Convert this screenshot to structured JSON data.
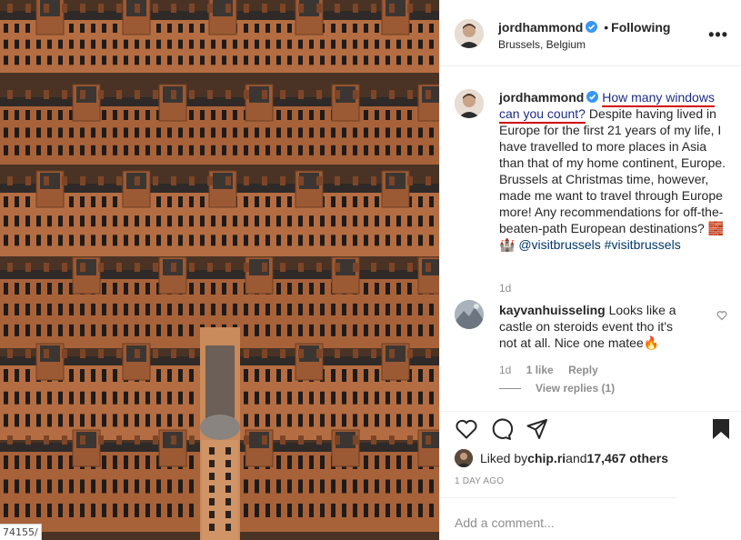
{
  "post": {
    "image_alt": "Aerial view of brick apartment blocks"
  },
  "url_stub": "74155/",
  "author": {
    "username": "jordhammond",
    "follow_status": "Following",
    "separator": "•",
    "location": "Brussels, Belgium"
  },
  "more_label": "•••",
  "caption": {
    "username": "jordhammond",
    "highlight": "How many windows can you count?",
    "body": " Despite having lived in Europe for the first 21 years of my life, I have travelled to more places in Asia than that of my home continent, Europe. Brussels at Christmas time, however, made me want to travel through Europe more! Any recommendations for off-the-beaten-path European destinations? 🧱🏰 ",
    "tag1": "@visitbrussels",
    "tag2": "#visitbrussels",
    "timestamp": "1d"
  },
  "comment": {
    "username": "kayvanhuisseling",
    "text": " Looks like a castle on steroids event tho it's not at all. Nice one matee🔥",
    "age": "1d",
    "likes": "1 like",
    "reply": "Reply",
    "view_replies": "View replies (1)"
  },
  "likes": {
    "prefix": "Liked by ",
    "user": "chip.ri",
    "mid": " and ",
    "count": "17,467 others"
  },
  "posted_ago": "1 DAY AGO",
  "add_comment": {
    "placeholder": "Add a comment..."
  },
  "colors": {
    "verified": "#3897f0",
    "link": "#00376b",
    "muted": "#8e8e8e",
    "annotation": "#d10000"
  }
}
